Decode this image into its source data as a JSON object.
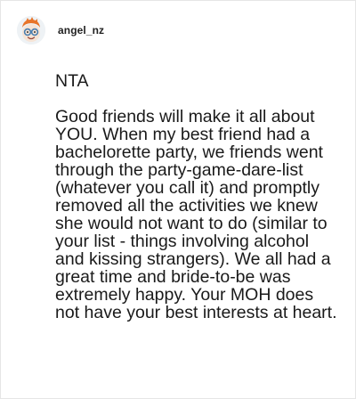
{
  "post": {
    "username": "angel_nz",
    "avatar_icon": "cartoon-face-avatar-icon",
    "paragraphs": [
      "NTA",
      "Good friends will make it all about YOU. When my best friend had a bachelorette party, we friends went through the party-game-dare-list (whatever you call it) and promptly removed all the activities we knew she would not want to do (similar to your list - things involving alcohol and kissing strangers). We all had a great time and bride-to-be was extremely happy. Your MOH does not have your best interests at heart."
    ]
  },
  "colors": {
    "text": "#1a1a1a",
    "border": "#e6e6e6",
    "avatar_hair": "#e8752a",
    "avatar_glasses": "#4a7fb0"
  }
}
